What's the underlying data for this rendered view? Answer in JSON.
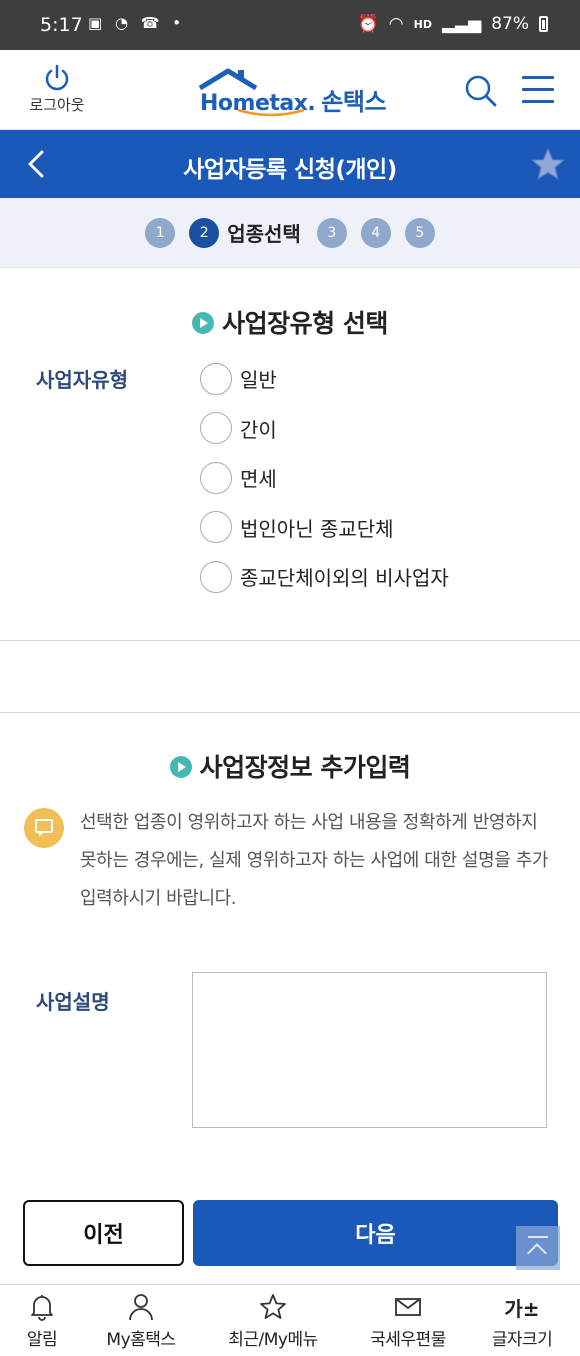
{
  "status_bar": {
    "time": "5:17",
    "battery": "87%",
    "network": "HD"
  },
  "header": {
    "logout_label": "로그아웃",
    "logo_text": "Hometax.",
    "logo_korean": "손택스"
  },
  "titlebar": {
    "title": "사업자등록 신청(개인)"
  },
  "steps": {
    "items": [
      "1",
      "2",
      "3",
      "4",
      "5"
    ],
    "active": "2",
    "active_label": "업종선택"
  },
  "section1": {
    "title": "사업장유형 선택",
    "field_label": "사업자유형",
    "options": [
      "일반",
      "간이",
      "면세",
      "법인아닌 종교단체",
      "종교단체이외의 비사업자"
    ]
  },
  "section2": {
    "title": "사업장정보 추가입력",
    "info_text": "선택한 업종이 영위하고자 하는 사업 내용을 정확하게 반영하지 못하는 경우에는, 실제 영위하고자 하는 사업에 대한 설명을 추가 입력하시기 바랍니다.",
    "field_label": "사업설명",
    "textarea_value": ""
  },
  "buttons": {
    "prev": "이전",
    "next": "다음"
  },
  "bottom_nav": {
    "items": [
      {
        "label": "알림",
        "icon": "bell-icon"
      },
      {
        "label": "My홈택스",
        "icon": "person-icon"
      },
      {
        "label": "최근/My메뉴",
        "icon": "star-icon"
      },
      {
        "label": "국세우편물",
        "icon": "mail-icon"
      },
      {
        "label": "글자크기",
        "icon": "font-size-icon",
        "glyph": "가±"
      }
    ]
  },
  "colors": {
    "primary": "#1b59b8",
    "step_inactive": "#8fa8cc",
    "step_active": "#1b4fa0",
    "accent_teal": "#45b8b4",
    "info_yellow": "#f2be56",
    "label_navy": "#2d4a78"
  }
}
